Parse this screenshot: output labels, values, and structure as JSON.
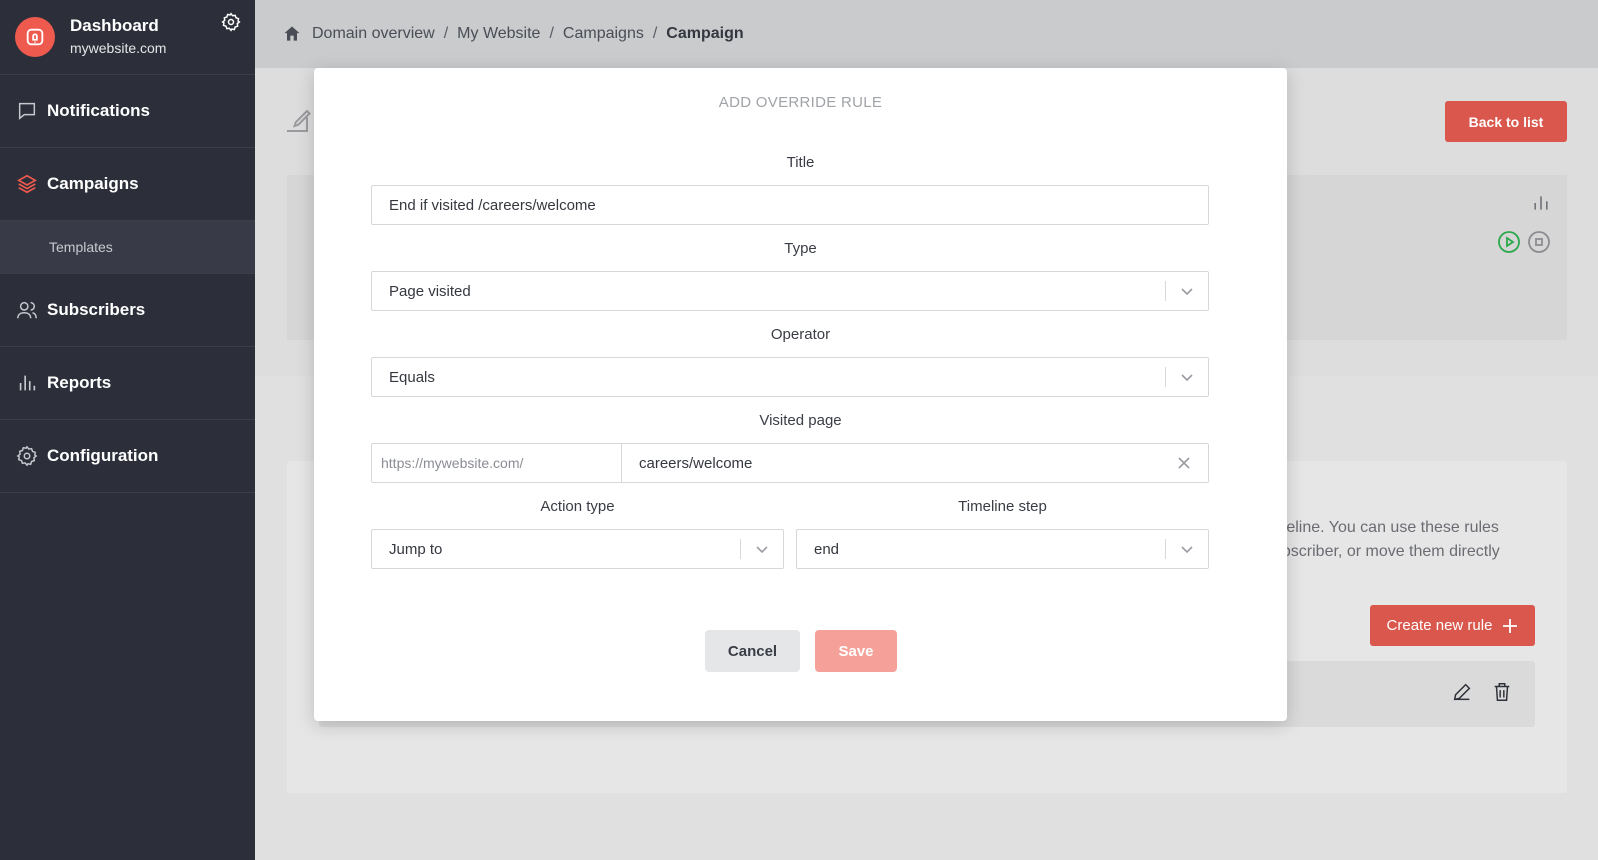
{
  "sidebar": {
    "brand_title": "Dashboard",
    "brand_subtitle": "mywebsite.com",
    "items": [
      {
        "label": "Notifications",
        "icon": "chat-bubble-icon"
      },
      {
        "label": "Campaigns",
        "icon": "layers-icon",
        "active": true
      },
      {
        "label": "Templates",
        "sub": true
      },
      {
        "label": "Subscribers",
        "icon": "users-icon"
      },
      {
        "label": "Reports",
        "icon": "bar-chart-icon"
      },
      {
        "label": "Configuration",
        "icon": "gear-icon"
      }
    ]
  },
  "breadcrumb": {
    "items": [
      "Domain overview",
      "My Website",
      "Campaigns"
    ],
    "current": "Campaign",
    "separator": "/"
  },
  "page": {
    "back_label": "Back to list",
    "rules_text": "timeline. You can use these rules subscriber, or move them directly",
    "create_rule_label": "Create new rule"
  },
  "modal": {
    "title": "ADD OVERRIDE RULE",
    "title_label": "Title",
    "title_value": "End if visited /careers/welcome",
    "type_label": "Type",
    "type_value": "Page visited",
    "operator_label": "Operator",
    "operator_value": "Equals",
    "visited_label": "Visited page",
    "visited_prefix": "https://mywebsite.com/",
    "visited_value": "careers/welcome",
    "action_label": "Action type",
    "action_value": "Jump to",
    "timeline_label": "Timeline step",
    "timeline_value": "end",
    "cancel_label": "Cancel",
    "save_label": "Save"
  },
  "colors": {
    "accent": "#ef5a4e",
    "sidebar_bg": "#2c2f3a",
    "save_disabled": "#f5a19a"
  }
}
